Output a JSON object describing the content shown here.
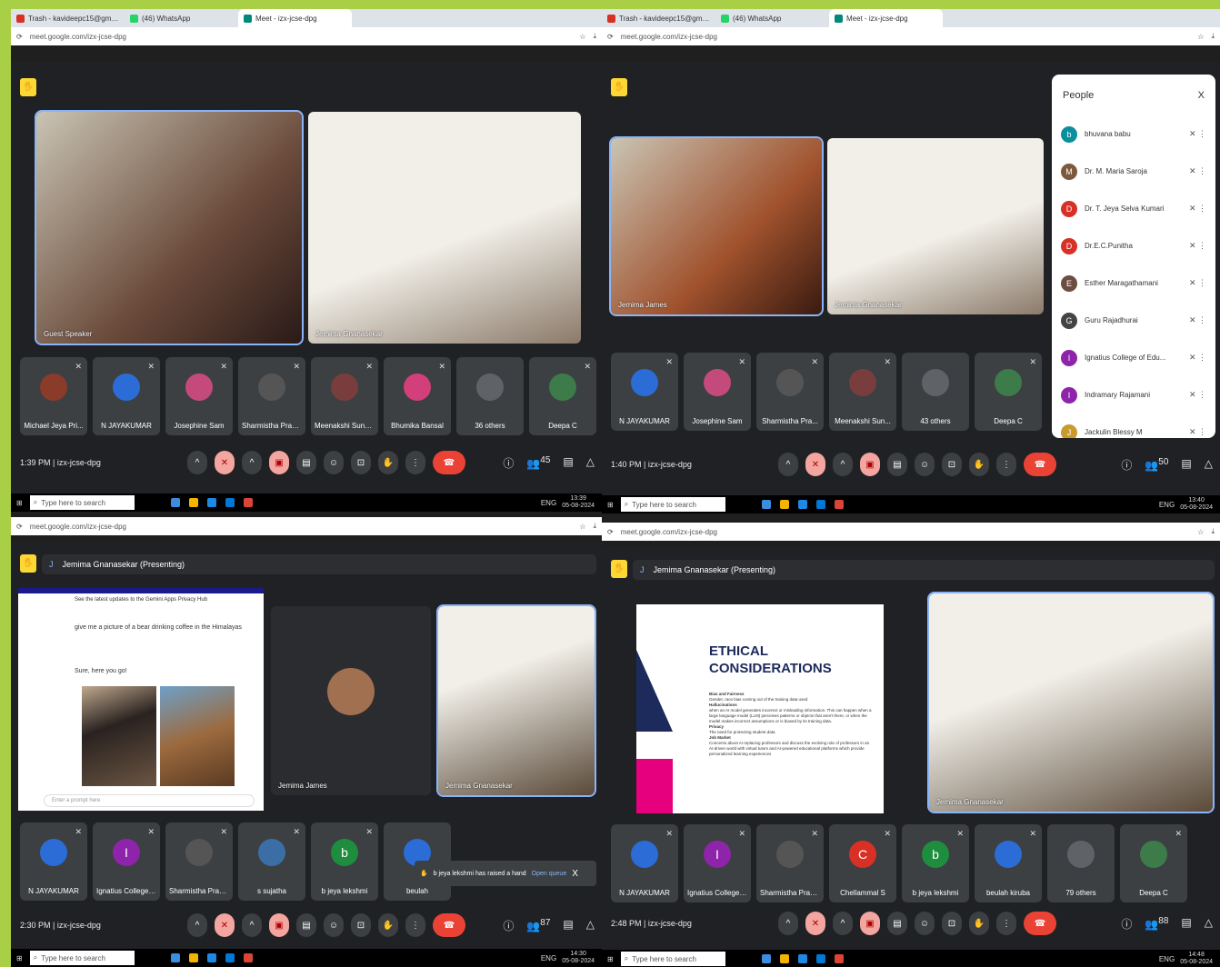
{
  "browser_tabs": [
    "Trash - kavideepc15@gmail.co",
    "(46) WhatsApp",
    "Meet - izx-jcse-dpg"
  ],
  "url": "meet.google.com/izx-jcse-dpg",
  "taskbar": {
    "search_placeholder": "Type here to search",
    "lang": "ENG",
    "date": "05-08-2024"
  },
  "q1": {
    "time_label": "1:39 PM  |  izx-jcse-dpg",
    "tiles": [
      {
        "name": "Guest Speaker"
      },
      {
        "name": "Jemima Gnanasekar"
      }
    ],
    "participants": [
      {
        "name": "Michael Jeya Pri...",
        "color": "#8a3b2a"
      },
      {
        "name": "N JAYAKUMAR",
        "color": "#2b6cd6"
      },
      {
        "name": "Josephine Sam",
        "color": "#c44a7c"
      },
      {
        "name": "Sharmistha Pram...",
        "color": "#555"
      },
      {
        "name": "Meenakshi Sundar",
        "color": "#7a3d3d"
      },
      {
        "name": "Bhumika Bansal",
        "color": "#d23f7a"
      },
      {
        "name": "36 others",
        "color": "#5f6368"
      },
      {
        "name": "Deepa C",
        "color": "#3d7b4a"
      }
    ],
    "people_count": "45",
    "hand_count": "1"
  },
  "q2": {
    "time_label": "1:40 PM  |  izx-jcse-dpg",
    "tiles": [
      {
        "name": "Jemima James"
      },
      {
        "name": "Jemima Gnanasekar"
      }
    ],
    "participants": [
      {
        "name": "N JAYAKUMAR",
        "color": "#2b6cd6"
      },
      {
        "name": "Josephine Sam",
        "color": "#c44a7c"
      },
      {
        "name": "Sharmistha Pra...",
        "color": "#555"
      },
      {
        "name": "Meenakshi Sun...",
        "color": "#7a3d3d"
      },
      {
        "name": "43 others",
        "color": "#5f6368"
      },
      {
        "name": "Deepa C",
        "color": "#3d7b4a"
      }
    ],
    "people_panel": {
      "title": "People",
      "close": "X",
      "list": [
        {
          "name": "bhuvana babu",
          "initial": "b",
          "color": "#0b8f9c"
        },
        {
          "name": "Dr. M. Maria Saroja",
          "initial": "M",
          "color": "#7d5a3e"
        },
        {
          "name": "Dr. T. Jeya Selva Kumari",
          "initial": "D",
          "color": "#d93025"
        },
        {
          "name": "Dr.E.C.Punitha",
          "initial": "D",
          "color": "#d93025"
        },
        {
          "name": "Esther Maragathamani",
          "initial": "E",
          "color": "#6d4c41"
        },
        {
          "name": "Guru Rajadhurai",
          "initial": "G",
          "color": "#444"
        },
        {
          "name": "Ignatius College of Edu...",
          "initial": "I",
          "color": "#8e24aa"
        },
        {
          "name": "Indramary Rajamani",
          "initial": "I",
          "color": "#8e24aa"
        },
        {
          "name": "Jackulin Blessy M",
          "initial": "J",
          "color": "#c79b2e"
        }
      ]
    },
    "people_count": "50",
    "hand_count": "1"
  },
  "q3": {
    "time_label": "2:30 PM  |  izx-jcse-dpg",
    "presenting": "Jemima Gnanasekar (Presenting)",
    "gemini": {
      "banner": "See the latest updates to the Gemini Apps Privacy Hub",
      "prompt": "give me a picture of a bear drinking coffee in the Himalayas",
      "reply": "Sure, here you go!",
      "input_placeholder": "Enter a prompt here"
    },
    "tiles": [
      {
        "name": "Jemima James"
      },
      {
        "name": "Jemima Gnanasekar"
      }
    ],
    "participants": [
      {
        "name": "N JAYAKUMAR",
        "color": "#2b6cd6",
        "initial": ""
      },
      {
        "name": "Ignatius College ...",
        "color": "#8e24aa",
        "initial": "I"
      },
      {
        "name": "Sharmistha Pram...",
        "color": "#555",
        "initial": ""
      },
      {
        "name": "s sujatha",
        "color": "#3b6ea5",
        "initial": ""
      },
      {
        "name": "b jeya lekshmi",
        "color": "#1e8e3e",
        "initial": "b"
      },
      {
        "name": "beulah",
        "color": "#2b6cd6",
        "initial": ""
      }
    ],
    "raised_hand": {
      "text": "b jeya lekshmi has raised a hand",
      "action": "Open queue",
      "close": "X"
    },
    "people_count": "87",
    "hand_count": "1"
  },
  "q4": {
    "time_label": "2:48 PM  |  izx-jcse-dpg",
    "presenting": "Jemima Gnanasekar (Presenting)",
    "slide": {
      "title": "ETHICAL CONSIDERATIONS",
      "sections": [
        {
          "h": "Bias and Fairness",
          "t": "Gender, race bias coming out of the training data used"
        },
        {
          "h": "Hallucinations",
          "t": "when an AI model generates incorrect or misleading information. This can happen when a large language model (LLM) perceives patterns or objects that aren't there, or when the model makes incorrect assumptions or is biased by its training data."
        },
        {
          "h": "Privacy",
          "t": "The need for protecting student data"
        },
        {
          "h": "Job Market",
          "t": "Concerns about AI replacing professors and discuss the evolving role of professors in an AI-driven world with virtual tutors and AI-powered educational platforms which provide personalized learning experiences"
        }
      ]
    },
    "tiles": [
      {
        "name": "Jemima Gnanasekar"
      }
    ],
    "participants": [
      {
        "name": "N JAYAKUMAR",
        "color": "#2b6cd6",
        "initial": ""
      },
      {
        "name": "Ignatius College ...",
        "color": "#8e24aa",
        "initial": "I"
      },
      {
        "name": "Sharmistha Pram...",
        "color": "#555",
        "initial": ""
      },
      {
        "name": "Chellammal S",
        "color": "#d93025",
        "initial": "C"
      },
      {
        "name": "b jeya lekshmi",
        "color": "#1e8e3e",
        "initial": "b"
      },
      {
        "name": "beulah kiruba",
        "color": "#2b6cd6",
        "initial": ""
      },
      {
        "name": "79 others",
        "color": "#5f6368",
        "initial": ""
      },
      {
        "name": "Deepa C",
        "color": "#3d7b4a",
        "initial": ""
      }
    ],
    "people_count": "88",
    "hand_count": "1"
  },
  "clock_times": [
    "13:39",
    "13:40",
    "14:30",
    "14:48"
  ],
  "colors": {
    "meet_bg": "#202124",
    "tile": "#3c4043",
    "end_call": "#ea4335",
    "accent": "#8ab4f8",
    "page_bg": "#a9cf46"
  }
}
